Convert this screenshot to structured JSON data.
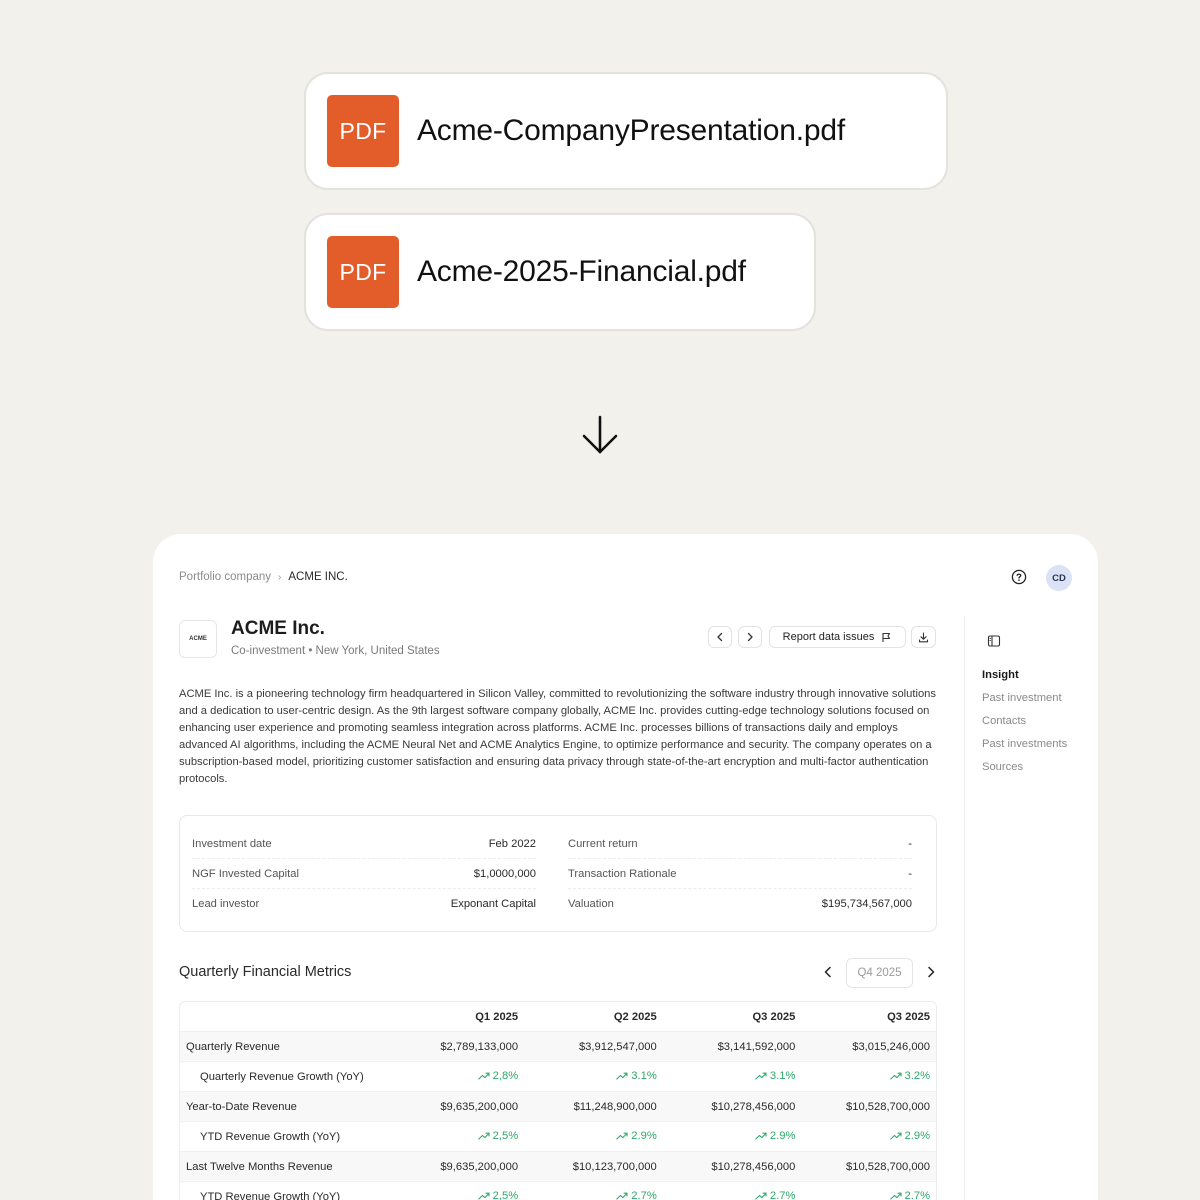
{
  "files": [
    {
      "badge": "PDF",
      "name": "Acme-CompanyPresentation.pdf"
    },
    {
      "badge": "PDF",
      "name": "Acme-2025-Financial.pdf"
    }
  ],
  "breadcrumb": {
    "parent": "Portfolio company",
    "separator": "›",
    "current": "ACME INC."
  },
  "avatar": "CD",
  "company": {
    "logo_text": "ACME",
    "name": "ACME Inc.",
    "subtitle": "Co-investment • New York, United States",
    "description": "ACME Inc. is a pioneering technology firm headquartered in Silicon Valley, committed to revolutionizing the software industry through innovative solutions and a dedication to user-centric design. As the 9th largest software company globally, ACME Inc. provides cutting-edge technology solutions focused on enhancing user experience and promoting seamless integration across platforms. ACME Inc. processes billions of transactions daily and employs advanced AI algorithms, including the ACME Neural Net and ACME Analytics Engine, to optimize performance and security. The company operates on a subscription-based model, prioritizing customer satisfaction and ensuring data privacy through state-of-the-art encryption and multi-factor authentication protocols."
  },
  "actions": {
    "report_label": "Report data issues"
  },
  "info": {
    "left": [
      {
        "label": "Investment date",
        "value": "Feb 2022"
      },
      {
        "label": "NGF Invested Capital",
        "value": "$1,0000,000"
      },
      {
        "label": "Lead investor",
        "value": "Exponant Capital"
      }
    ],
    "right": [
      {
        "label": "Current return",
        "value": "-"
      },
      {
        "label": "Transaction Rationale",
        "value": "-"
      },
      {
        "label": "Valuation",
        "value": "$195,734,567,000"
      }
    ]
  },
  "metrics": {
    "title": "Quarterly Financial Metrics",
    "selected_quarter": "Q4 2025",
    "columns": [
      "",
      "Q1 2025",
      "Q2 2025",
      "Q3 2025",
      "Q3 2025"
    ],
    "rows": [
      {
        "label": "Quarterly Revenue",
        "values": [
          "$2,789,133,000",
          "$3,912,547,000",
          "$3,141,592,000",
          "$3,015,246,000"
        ],
        "sub": false
      },
      {
        "label": "Quarterly Revenue Growth (YoY)",
        "values": [
          "2,8%",
          "3.1%",
          "3.1%",
          "3.2%"
        ],
        "sub": true
      },
      {
        "label": "Year-to-Date Revenue",
        "values": [
          "$9,635,200,000",
          "$11,248,900,000",
          "$10,278,456,000",
          "$10,528,700,000"
        ],
        "sub": false
      },
      {
        "label": "YTD Revenue Growth (YoY)",
        "values": [
          "2,5%",
          "2.9%",
          "2.9%",
          "2.9%"
        ],
        "sub": true
      },
      {
        "label": "Last Twelve Months Revenue",
        "values": [
          "$9,635,200,000",
          "$10,123,700,000",
          "$10,278,456,000",
          "$10,528,700,000"
        ],
        "sub": false
      },
      {
        "label": "YTD Revenue Growth (YoY)",
        "values": [
          "2,5%",
          "2.7%",
          "2.7%",
          "2.7%"
        ],
        "sub": true
      }
    ]
  },
  "toc": [
    "Insight",
    "Past investment",
    "Contacts",
    "Past investments",
    "Sources"
  ],
  "colors": {
    "pdf_badge": "#e35d2a",
    "growth": "#2fa86a",
    "avatar_bg": "#dbe2f6"
  }
}
